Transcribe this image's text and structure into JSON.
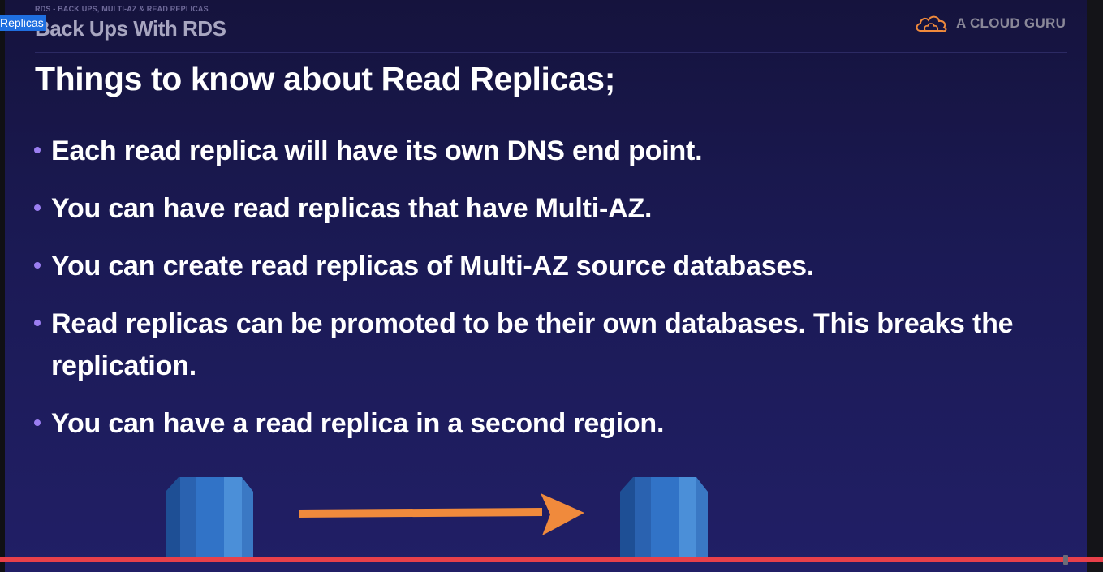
{
  "player": {
    "chapter_tag": "Replicas",
    "progress_fraction": 0.966
  },
  "slide": {
    "breadcrumb": "RDS - BACK UPS, MULTI-AZ & READ REPLICAS",
    "section_title": "Back Ups With RDS",
    "brand": "A CLOUD GURU",
    "heading": "Things to know about Read Replicas;",
    "bullets": [
      "Each read replica will have its own DNS end point.",
      "You can have read replicas that have Multi-AZ.",
      "You can create read replicas of Multi-AZ source databases.",
      "Read replicas can be promoted to be their own databases. This breaks the replication.",
      "You can have a read replica in a second region."
    ]
  },
  "colors": {
    "accent_orange": "#f08a3c",
    "bullet_dot": "#9b7ef2",
    "progress": "#e8404a"
  },
  "icons": [
    "cloud-logo-icon",
    "rds-database-icon",
    "arrow-right-icon"
  ]
}
